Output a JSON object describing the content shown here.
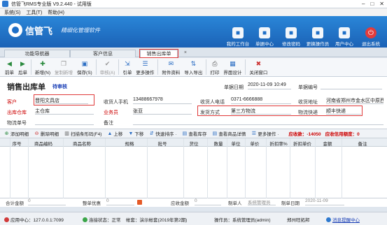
{
  "window": {
    "title": "信管飞RMS专业版 V9.2.440 - 试用版"
  },
  "menu": [
    "系统(S)",
    "工具(T)",
    "帮助(H)"
  ],
  "banner": {
    "brand": "信管飞",
    "slogan": "精细化管理软件",
    "tools": [
      {
        "label": "我的工作台",
        "icon": "monitor-icon"
      },
      {
        "label": "单据中心",
        "icon": "document-icon"
      },
      {
        "label": "修改密码",
        "icon": "lock-icon"
      },
      {
        "label": "更换操作员",
        "icon": "user-switch-icon"
      },
      {
        "label": "用户中心",
        "icon": "users-icon"
      },
      {
        "label": "退出系统",
        "icon": "power-icon"
      }
    ]
  },
  "tabs": [
    "功能导航器",
    "客户信息",
    "销售出库单"
  ],
  "toolbar": [
    {
      "label": "前单",
      "icon": "arrow-left-icon",
      "sym": "◀",
      "color": "#2b8a3e"
    },
    {
      "label": "后单",
      "icon": "arrow-right-icon",
      "sym": "▶",
      "color": "#2b8a3e"
    },
    {
      "label": "新增(N)",
      "icon": "add-icon",
      "sym": "✚",
      "color": "#2b8a3e"
    },
    {
      "label": "复制新增",
      "icon": "copy-add-icon",
      "sym": "❐",
      "color": "#999",
      "disabled": true
    },
    {
      "label": "保存(S)",
      "icon": "save-icon",
      "sym": "▣",
      "color": "#2d6fc4"
    },
    {
      "label": "审核(A)",
      "icon": "approve-icon",
      "sym": "✔",
      "color": "#999",
      "disabled": true
    },
    {
      "label": "引单",
      "icon": "reference-icon",
      "sym": "⇲",
      "color": "#2d6fc4"
    },
    {
      "label": "更多操作",
      "icon": "more-icon",
      "sym": "☰",
      "color": "#2d6fc4"
    },
    {
      "label": "附件资料",
      "icon": "attachment-icon",
      "sym": "✉",
      "color": "#2d6fc4"
    },
    {
      "label": "导入导出",
      "icon": "import-export-icon",
      "sym": "⇅",
      "color": "#2d6fc4"
    },
    {
      "label": "打印",
      "icon": "print-icon",
      "sym": "⎙",
      "color": "#555"
    },
    {
      "label": "界面设计",
      "icon": "design-icon",
      "sym": "▦",
      "color": "#2d6fc4"
    },
    {
      "label": "关闭窗口",
      "icon": "close-window-icon",
      "sym": "✖",
      "color": "#c33"
    }
  ],
  "form": {
    "title": "销售出库单",
    "status": "待审核",
    "date_label": "单据日期",
    "date_value": "2020-11-09 10:49",
    "number_label": "单据编号",
    "customer_label": "客户",
    "customer_value": "晋阳文具店",
    "receiver_phone_label": "收货人手机",
    "receiver_phone_value": "13488667978",
    "receiver_tel_label": "收货人电话",
    "receiver_tel_value": "0371-6666888",
    "address_label": "收货地址",
    "address_value": "河南省郑州市金水区中原西",
    "warehouse_label": "出库仓库",
    "warehouse_value": "主仓库",
    "salesman_label": "业务员",
    "salesman_value": "张亚",
    "delivery_label": "发货方式",
    "delivery_value": "第三方物流",
    "logistics_label": "物流快递",
    "logistics_value": "顺丰快递",
    "tracking_label": "物流单号",
    "remark_label": "备注"
  },
  "gridbar": {
    "buttons": [
      {
        "label": "添加明细",
        "sym": "⊕",
        "color": "#2b8a3e"
      },
      {
        "label": "删除明细",
        "sym": "⊖",
        "color": "#c33"
      },
      {
        "label": "扫描条形码(F4)",
        "sym": "▥",
        "color": "#555"
      },
      {
        "label": "上移",
        "sym": "▲",
        "color": "#2d6fc4"
      },
      {
        "label": "下移",
        "sym": "▼",
        "color": "#2d6fc4"
      },
      {
        "label": "快速排序 ·",
        "sym": "⇵",
        "color": "#2d6fc4"
      },
      {
        "label": "查看库存",
        "sym": "▤",
        "color": "#2d6fc4"
      },
      {
        "label": "查看商品详情",
        "sym": "▤",
        "color": "#2d6fc4"
      },
      {
        "label": "更多操作 ·",
        "sym": "☰",
        "color": "#2d6fc4"
      }
    ],
    "receivable": "应收款：-14050",
    "credit": "应收信用额度：0"
  },
  "table": {
    "columns": [
      "序号",
      "商品编码",
      "商品名称",
      "规格",
      "批号",
      "货位",
      "数量",
      "单位",
      "单价",
      "折扣率%",
      "折扣单价",
      "金额",
      "备注"
    ]
  },
  "totals": {
    "total_label": "合计金额",
    "total_value": "0",
    "discount_label": "整单优惠",
    "discount_value": "0",
    "receivable_label": "应收金额",
    "receivable_value": "0",
    "maker_label": "制单人",
    "maker_value": "系统管理员",
    "make_date_label": "制单日期",
    "make_date_value": "2020-11-09"
  },
  "status": {
    "app_center": "应用中心：127.0.0.1:7099",
    "connection": "连接状态：正常",
    "account": "帐套：演示帐套(2019年第2期)",
    "operator": "操作员：系统管理员(admin)",
    "branch": "郑州旺拓邦",
    "message": "消息提醒中心"
  }
}
